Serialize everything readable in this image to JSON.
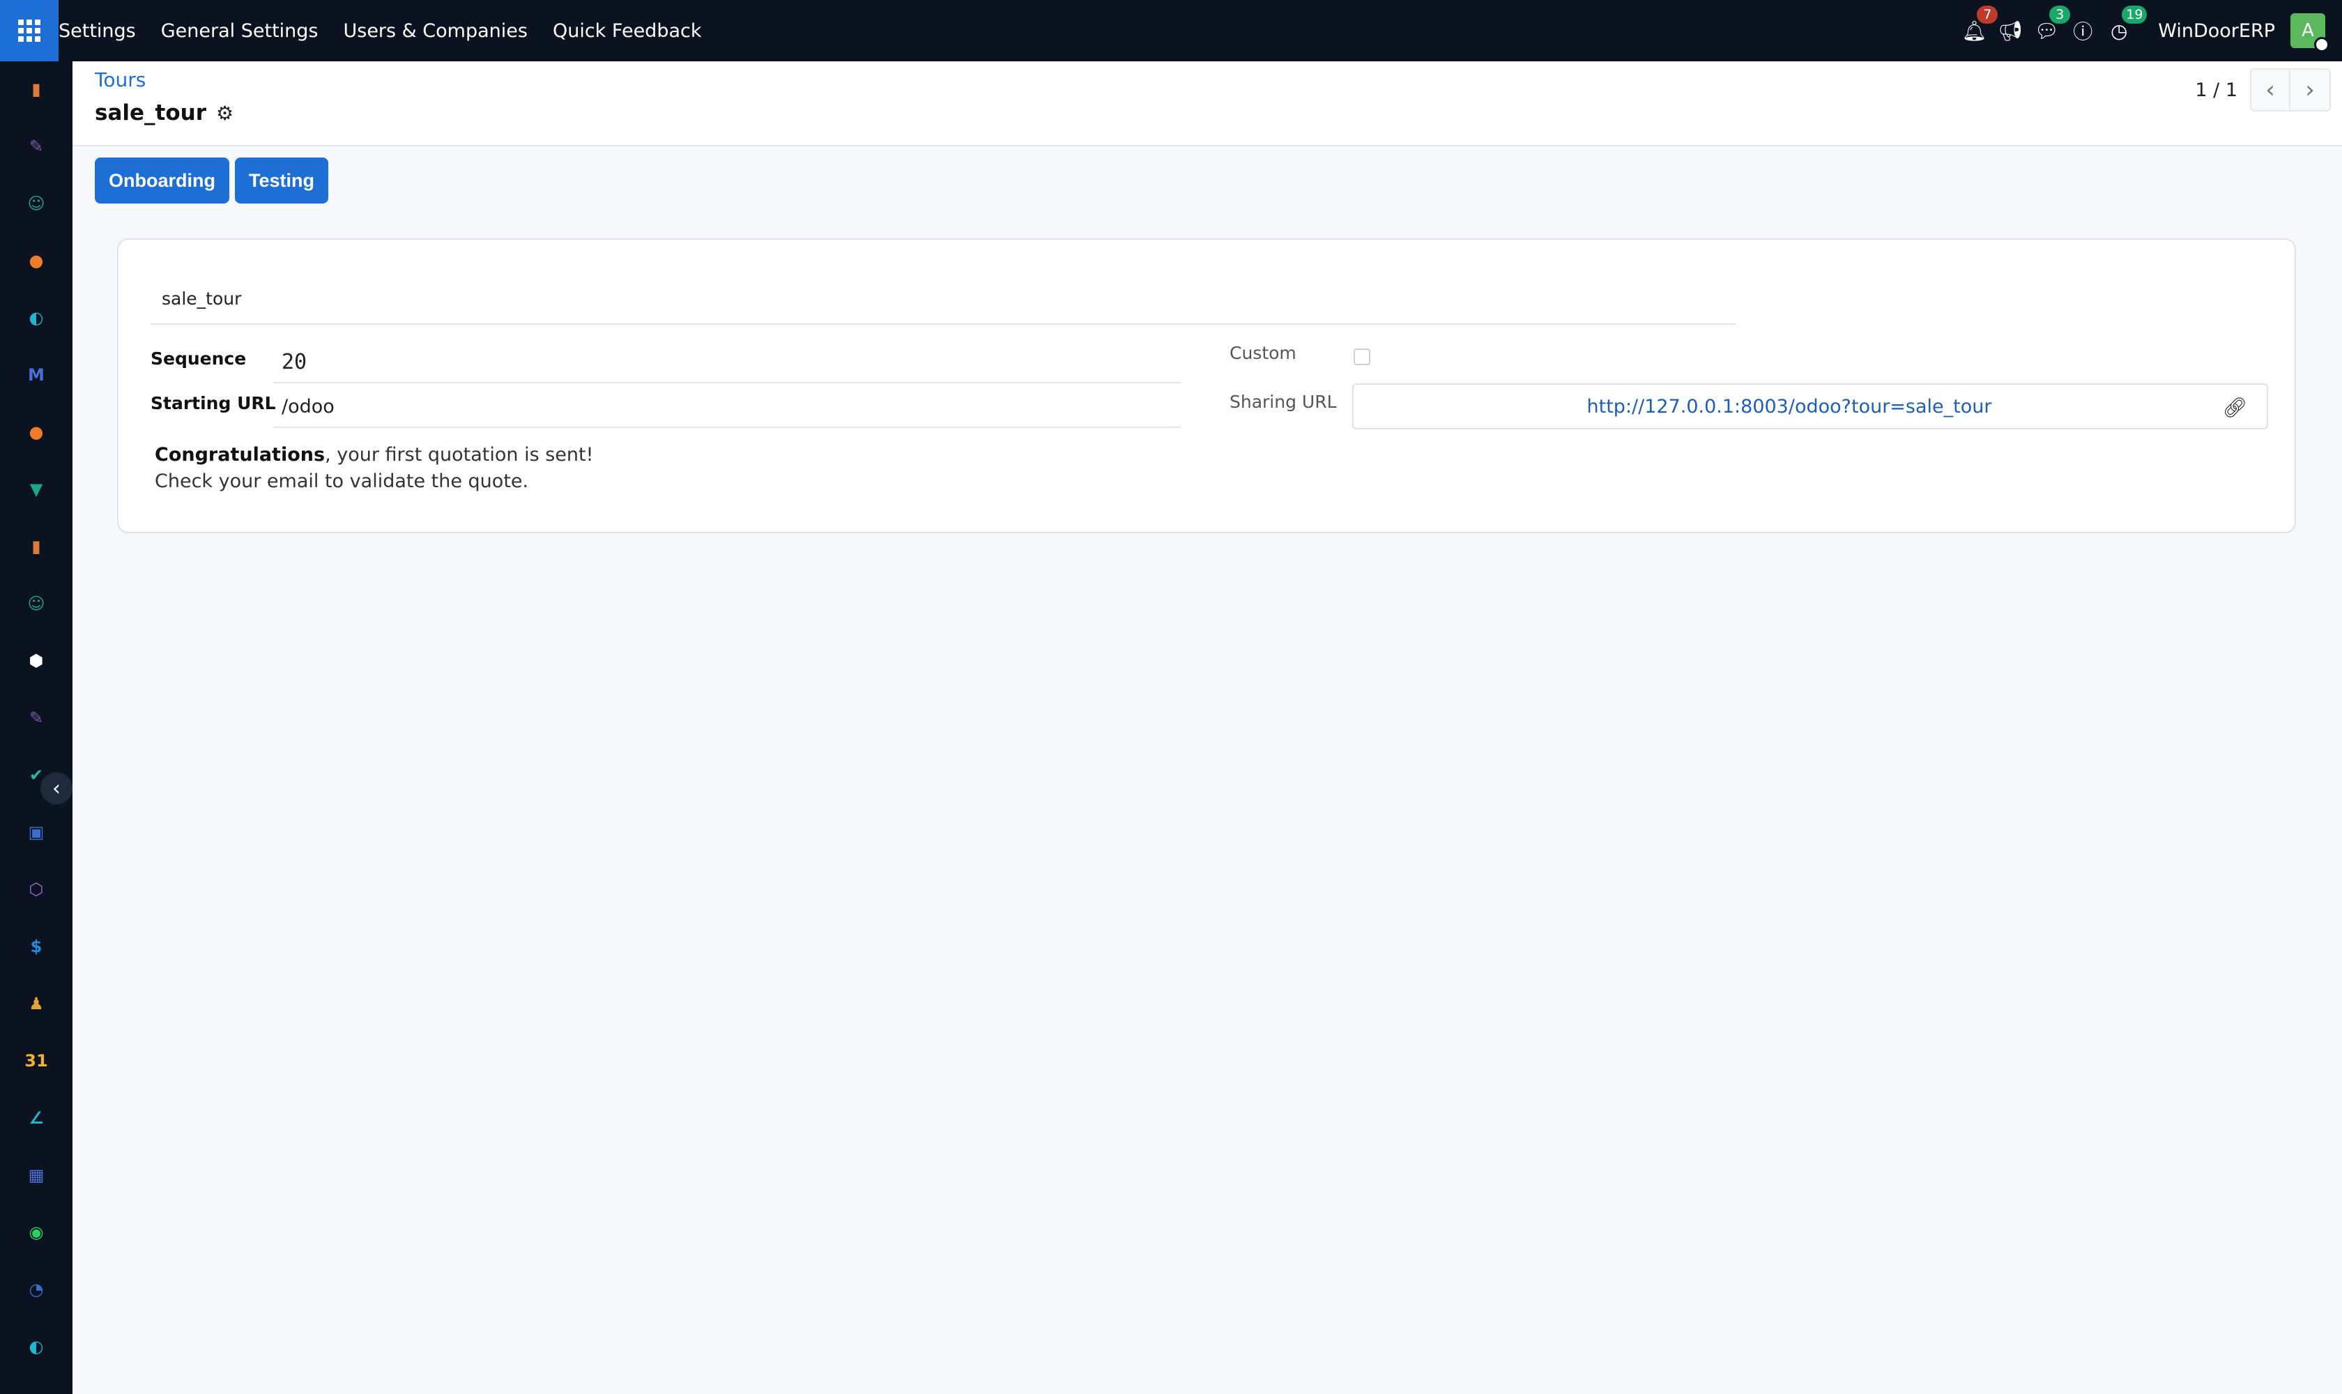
{
  "navbar": {
    "menu": [
      "Settings",
      "General Settings",
      "Users & Companies",
      "Quick Feedback"
    ],
    "notifications_count": "7",
    "messages_count": "3",
    "activities_count": "19",
    "company": "WinDoorERP",
    "avatar_letter": "A"
  },
  "sidebar": {
    "apps": [
      {
        "icon": "dashboards-icon",
        "color": "#e07a3a",
        "glyph": "▮"
      },
      {
        "icon": "knowledge-icon",
        "color": "#7b5ea7",
        "glyph": "✎"
      },
      {
        "icon": "contacts-icon",
        "color": "#19a088",
        "glyph": "☺"
      },
      {
        "icon": "discuss-icon",
        "color": "#f07b2a",
        "glyph": "●"
      },
      {
        "icon": "website-icon",
        "color": "#1fb6d0",
        "glyph": "◐"
      },
      {
        "icon": "email-marketing-icon",
        "color": "#4b6fd6",
        "glyph": "M"
      },
      {
        "icon": "live-chat-icon",
        "color": "#f07b2a",
        "glyph": "●"
      },
      {
        "icon": "events-icon",
        "color": "#1aa88a",
        "glyph": "▼"
      },
      {
        "icon": "spreadsheet-icon",
        "color": "#e07a3a",
        "glyph": "▮"
      },
      {
        "icon": "employees-icon",
        "color": "#19a088",
        "glyph": "☺"
      },
      {
        "icon": "inventory-icon",
        "color": "#ffffff",
        "glyph": "⬢"
      },
      {
        "icon": "planning-icon",
        "color": "#7b5ea7",
        "glyph": "✎"
      },
      {
        "icon": "project-icon",
        "color": "#26b7a4",
        "glyph": "✔"
      },
      {
        "icon": "elearning-icon",
        "color": "#3a6fd0",
        "glyph": "▣"
      },
      {
        "icon": "manufacturing-icon",
        "color": "#9b6bd6",
        "glyph": "⬡"
      },
      {
        "icon": "invoicing-icon",
        "color": "#1d8fe0",
        "glyph": "$"
      },
      {
        "icon": "team-icon",
        "color": "#e0a33a",
        "glyph": "♟"
      },
      {
        "icon": "calendar-icon",
        "color": "#f0b429",
        "glyph": "31"
      },
      {
        "icon": "sign-icon",
        "color": "#1fb6d0",
        "glyph": "∠"
      },
      {
        "icon": "apps-store-icon",
        "color": "#4b6fd6",
        "glyph": "▦"
      },
      {
        "icon": "whatsapp-icon",
        "color": "#25d366",
        "glyph": "◉"
      },
      {
        "icon": "timesheets-icon",
        "color": "#3a6fd0",
        "glyph": "◔"
      },
      {
        "icon": "helpdesk-icon",
        "color": "#1fb6d0",
        "glyph": "◐"
      }
    ]
  },
  "control": {
    "breadcrumb": "Tours",
    "title": "sale_tour",
    "pager_value": "1 / 1"
  },
  "buttons": {
    "onboarding": "Onboarding",
    "testing": "Testing"
  },
  "form": {
    "name": "sale_tour",
    "sequence_label": "Sequence",
    "sequence_value": "20",
    "starting_url_label": "Starting URL",
    "starting_url_value": "/odoo",
    "custom_label": "Custom",
    "sharing_url_label": "Sharing URL",
    "sharing_url_value": "http://127.0.0.1:8003/odoo?tour=sale_tour",
    "message_bold": "Congratulations",
    "message_rest": ", your first quotation is sent!",
    "message_line2": "Check your email to validate the quote."
  }
}
